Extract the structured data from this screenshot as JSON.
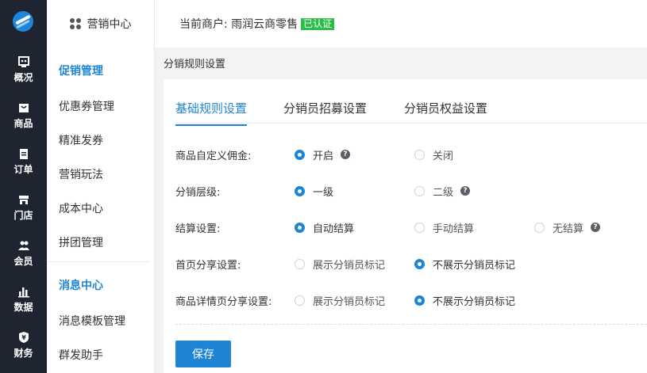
{
  "rail": {
    "items": [
      {
        "label": "概况",
        "icon": "overview-icon"
      },
      {
        "label": "商品",
        "icon": "goods-icon"
      },
      {
        "label": "订单",
        "icon": "order-icon"
      },
      {
        "label": "门店",
        "icon": "store-icon"
      },
      {
        "label": "会员",
        "icon": "member-icon"
      },
      {
        "label": "数据",
        "icon": "data-icon"
      },
      {
        "label": "财务",
        "icon": "finance-icon"
      }
    ]
  },
  "submenu": {
    "title": "营销中心",
    "groups": [
      {
        "label": "促销管理",
        "items": [
          "优惠券管理",
          "精准发券",
          "营销玩法",
          "成本中心",
          "拼团管理"
        ]
      },
      {
        "label": "消息中心",
        "items": [
          "消息模板管理",
          "群发助手"
        ]
      }
    ]
  },
  "topbar": {
    "merchant_label": "当前商户: 雨润云商零售",
    "verified_badge": "已认证"
  },
  "page": {
    "title": "分销规则设置"
  },
  "tabs": [
    {
      "label": "基础规则设置",
      "active": true
    },
    {
      "label": "分销员招募设置",
      "active": false
    },
    {
      "label": "分销员权益设置",
      "active": false
    }
  ],
  "form": {
    "rows": [
      {
        "label": "商品自定义佣金:",
        "options": [
          {
            "text": "开启",
            "checked": true,
            "help": true
          },
          {
            "text": "关闭",
            "checked": false
          }
        ]
      },
      {
        "label": "分销层级:",
        "options": [
          {
            "text": "一级",
            "checked": true
          },
          {
            "text": "二级",
            "checked": false,
            "help": true
          }
        ]
      },
      {
        "label": "结算设置:",
        "options": [
          {
            "text": "自动结算",
            "checked": true
          },
          {
            "text": "手动结算",
            "checked": false
          },
          {
            "text": "无结算",
            "checked": false,
            "help": true
          }
        ]
      },
      {
        "label": "首页分享设置:",
        "options": [
          {
            "text": "展示分销员标记",
            "checked": false
          },
          {
            "text": "不展示分销员标记",
            "checked": true
          }
        ]
      },
      {
        "label": "商品详情页分享设置:",
        "options": [
          {
            "text": "展示分销员标记",
            "checked": false
          },
          {
            "text": "不展示分销员标记",
            "checked": true
          }
        ]
      }
    ],
    "help_glyph": "?",
    "save_label": "保存"
  },
  "colors": {
    "accent": "#1e85d6",
    "rail_bg": "#1f2530",
    "badge_green": "#2bbd4a"
  }
}
